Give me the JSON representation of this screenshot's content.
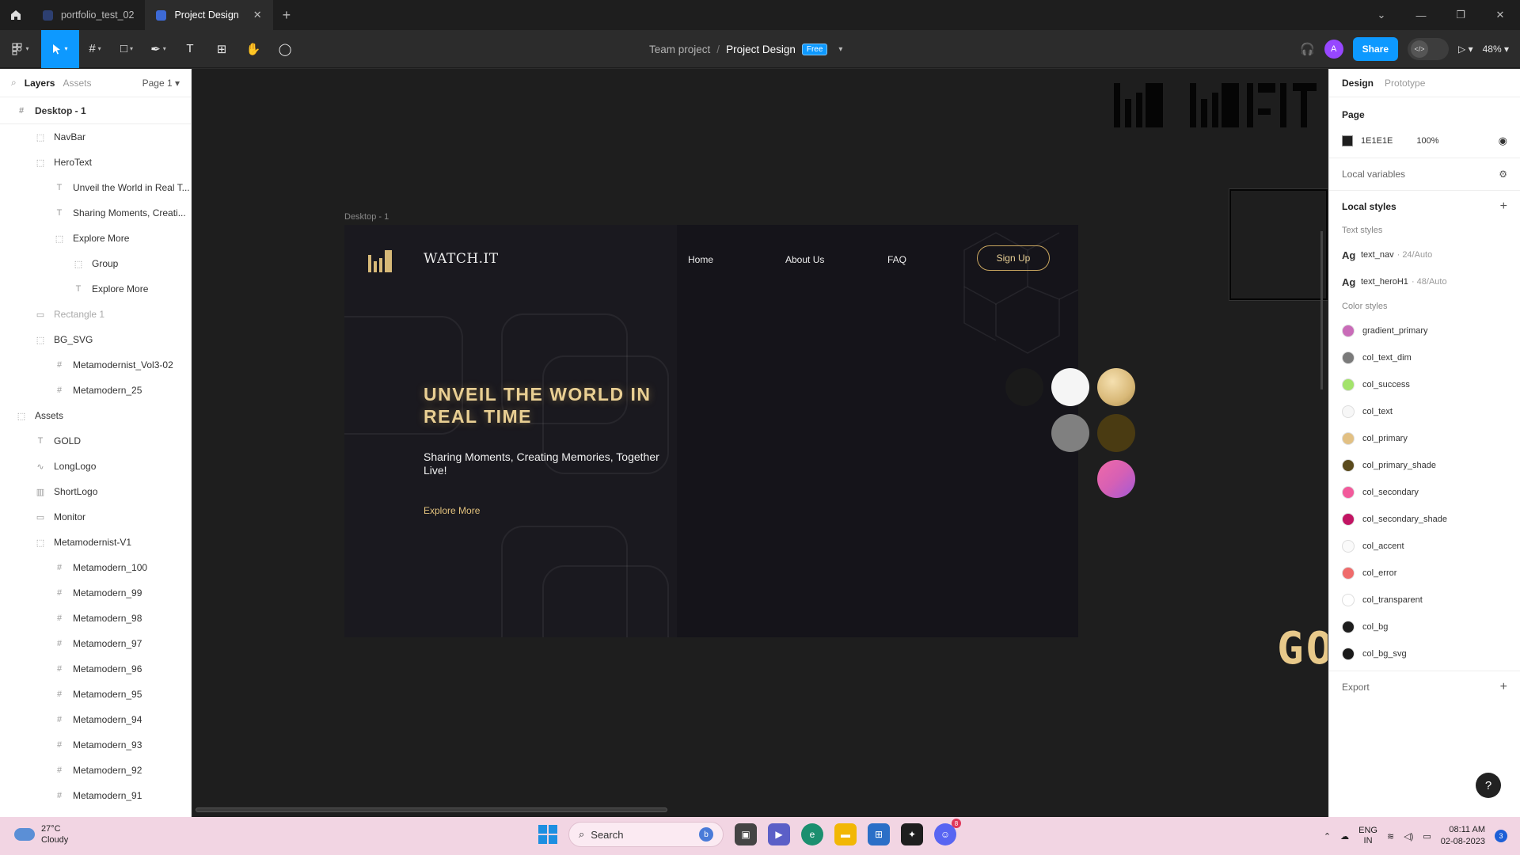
{
  "titlebar": {
    "tabs": [
      {
        "label": "portfolio_test_02",
        "active": false
      },
      {
        "label": "Project Design",
        "active": true
      }
    ],
    "new_tab": "+",
    "window_controls": [
      "⌄",
      "—",
      "❐",
      "✕"
    ]
  },
  "toolbar": {
    "team": "Team project",
    "separator": "/",
    "project": "Project Design",
    "plan_badge": "Free",
    "share_label": "Share",
    "avatar_initial": "A",
    "zoom": "48%"
  },
  "left_panel": {
    "tabs": {
      "layers": "Layers",
      "assets": "Assets",
      "page": "Page 1"
    },
    "layers": [
      {
        "label": "Desktop - 1",
        "indent": 0,
        "icon": "#",
        "kind": "frame"
      },
      {
        "label": "NavBar",
        "indent": 1,
        "icon": "⬚"
      },
      {
        "label": "HeroText",
        "indent": 1,
        "icon": "⬚"
      },
      {
        "label": "Unveil the World in Real T...",
        "indent": 2,
        "icon": "T"
      },
      {
        "label": "Sharing Moments, Creati...",
        "indent": 2,
        "icon": "T"
      },
      {
        "label": "Explore More",
        "indent": 2,
        "icon": "⬚"
      },
      {
        "label": "Group",
        "indent": 3,
        "icon": "⬚"
      },
      {
        "label": "Explore More",
        "indent": 3,
        "icon": "T"
      },
      {
        "label": "Rectangle 1",
        "indent": 1,
        "icon": "▭",
        "dim": true
      },
      {
        "label": "BG_SVG",
        "indent": 1,
        "icon": "⬚"
      },
      {
        "label": "Metamodernist_Vol3-02",
        "indent": 2,
        "icon": "#"
      },
      {
        "label": "Metamodern_25",
        "indent": 2,
        "icon": "#"
      },
      {
        "label": "Assets",
        "indent": 0,
        "icon": "⬚"
      },
      {
        "label": "GOLD",
        "indent": 1,
        "icon": "T"
      },
      {
        "label": "LongLogo",
        "indent": 1,
        "icon": "∿"
      },
      {
        "label": "ShortLogo",
        "indent": 1,
        "icon": "▥"
      },
      {
        "label": "Monitor",
        "indent": 1,
        "icon": "▭"
      },
      {
        "label": "Metamodernist-V1",
        "indent": 1,
        "icon": "⬚"
      },
      {
        "label": "Metamodern_100",
        "indent": 2,
        "icon": "#"
      },
      {
        "label": "Metamodern_99",
        "indent": 2,
        "icon": "#"
      },
      {
        "label": "Metamodern_98",
        "indent": 2,
        "icon": "#"
      },
      {
        "label": "Metamodern_97",
        "indent": 2,
        "icon": "#"
      },
      {
        "label": "Metamodern_96",
        "indent": 2,
        "icon": "#"
      },
      {
        "label": "Metamodern_95",
        "indent": 2,
        "icon": "#"
      },
      {
        "label": "Metamodern_94",
        "indent": 2,
        "icon": "#"
      },
      {
        "label": "Metamodern_93",
        "indent": 2,
        "icon": "#"
      },
      {
        "label": "Metamodern_92",
        "indent": 2,
        "icon": "#"
      },
      {
        "label": "Metamodern_91",
        "indent": 2,
        "icon": "#"
      }
    ]
  },
  "canvas": {
    "frame_label": "Desktop - 1",
    "artboard": {
      "brand": "WATCH.IT",
      "nav": [
        "Home",
        "About Us",
        "FAQ"
      ],
      "signup": "Sign Up",
      "hero_title": "UNVEIL THE WORLD IN REAL TIME",
      "hero_sub": "Sharing Moments, Creating Memories, Together Live!",
      "cta": "Explore More"
    },
    "gold_text": "GO",
    "swatch_colors": [
      "#1a1a1a",
      "#f5f5f5",
      "#d8b877",
      "#808080",
      "#4a3b12",
      "#d660b4"
    ]
  },
  "right_panel": {
    "tabs": {
      "design": "Design",
      "prototype": "Prototype"
    },
    "page": {
      "title": "Page",
      "color_hex": "1E1E1E",
      "opacity": "100%"
    },
    "local_variables": "Local variables",
    "local_styles": "Local styles",
    "text_styles_title": "Text styles",
    "text_styles": [
      {
        "name": "text_nav",
        "meta": "· 24/Auto"
      },
      {
        "name": "text_heroH1",
        "meta": "· 48/Auto"
      }
    ],
    "color_styles_title": "Color styles",
    "color_styles": [
      {
        "name": "gradient_primary",
        "color": "#c96bb8"
      },
      {
        "name": "col_text_dim",
        "color": "#7a7a7a"
      },
      {
        "name": "col_success",
        "color": "#a3e36b"
      },
      {
        "name": "col_text",
        "color": "#f7f7f7"
      },
      {
        "name": "col_primary",
        "color": "#e2c083"
      },
      {
        "name": "col_primary_shade",
        "color": "#5a4a1c"
      },
      {
        "name": "col_secondary",
        "color": "#f25a9b"
      },
      {
        "name": "col_secondary_shade",
        "color": "#c21463"
      },
      {
        "name": "col_accent",
        "color": "#fafafa"
      },
      {
        "name": "col_error",
        "color": "#ef6b6b"
      },
      {
        "name": "col_transparent",
        "color": "#ffffff"
      },
      {
        "name": "col_bg",
        "color": "#1e1e1e"
      },
      {
        "name": "col_bg_svg",
        "color": "#1a1a1a"
      }
    ],
    "export": "Export",
    "help": "?"
  },
  "taskbar": {
    "temperature": "27°C",
    "weather": "Cloudy",
    "search_placeholder": "Search",
    "lang_line1": "ENG",
    "lang_line2": "IN",
    "time": "08:11 AM",
    "date": "02-08-2023",
    "discord_badge": "8",
    "notif_count": "3"
  }
}
